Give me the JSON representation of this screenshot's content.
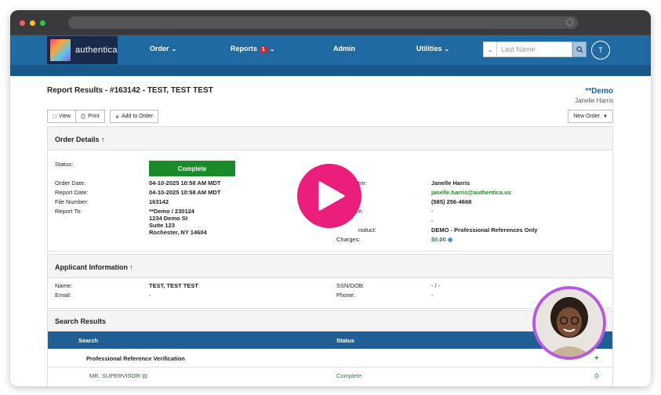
{
  "nav": {
    "brand": "authentica",
    "items": [
      {
        "label": "Order",
        "has_chevron": true
      },
      {
        "label": "Reports",
        "badge": "1",
        "has_chevron": true
      },
      {
        "label": "Admin",
        "has_chevron": false
      },
      {
        "label": "Utilities",
        "has_chevron": true
      }
    ],
    "search_placeholder": "Last Name",
    "user_initial": "T"
  },
  "page": {
    "title": "Report Results - #163142 - TEST, TEST TEST",
    "account_name": "**Demo",
    "account_user": "Janelle Harris"
  },
  "toolbar": {
    "view": "View",
    "print": "Print",
    "add_to_order": "Add to Order",
    "new_order": "New Order"
  },
  "order_details": {
    "heading": "Order Details",
    "status_label": "Status:",
    "status_value": "Complete",
    "left": [
      {
        "label": "Order Date:",
        "value": "04-10-2025 10:58 AM MDT"
      },
      {
        "label": "Report Date:",
        "value": "04-10-2025 10:58 AM MDT"
      },
      {
        "label": "File Number:",
        "value": "163142"
      },
      {
        "label": "Report To:",
        "value": "**Demo / 230124"
      }
    ],
    "address": [
      "1234 Demo St",
      "Suite 123",
      "Rochester, NY 14604"
    ],
    "right": [
      {
        "label": "tor:",
        "value": "Janelle Harris"
      },
      {
        "label": "",
        "value": "janelle.harris@authentica.us"
      },
      {
        "label": "",
        "value": "(585) 256-4668"
      },
      {
        "label": "e:",
        "value": "-"
      },
      {
        "label": "",
        "value": "-"
      },
      {
        "label": "roduct:",
        "value": "DEMO - Professional References Only"
      },
      {
        "label": "Charges:",
        "value": "$0.00"
      }
    ]
  },
  "applicant": {
    "heading": "Applicant Information",
    "name_label": "Name:",
    "name_value": "TEST, TEST TEST",
    "email_label": "Email:",
    "email_value": "-",
    "ssn_label": "SSN/DOB:",
    "ssn_value": "- / -",
    "phone_label": "Phone:",
    "phone_value": "-"
  },
  "search_results": {
    "heading": "Search Results",
    "col_search": "Search",
    "col_status": "Status",
    "group": "Professional Reference Verification",
    "row_name": "MR. SUPERVISOR",
    "row_status": "Complete"
  }
}
